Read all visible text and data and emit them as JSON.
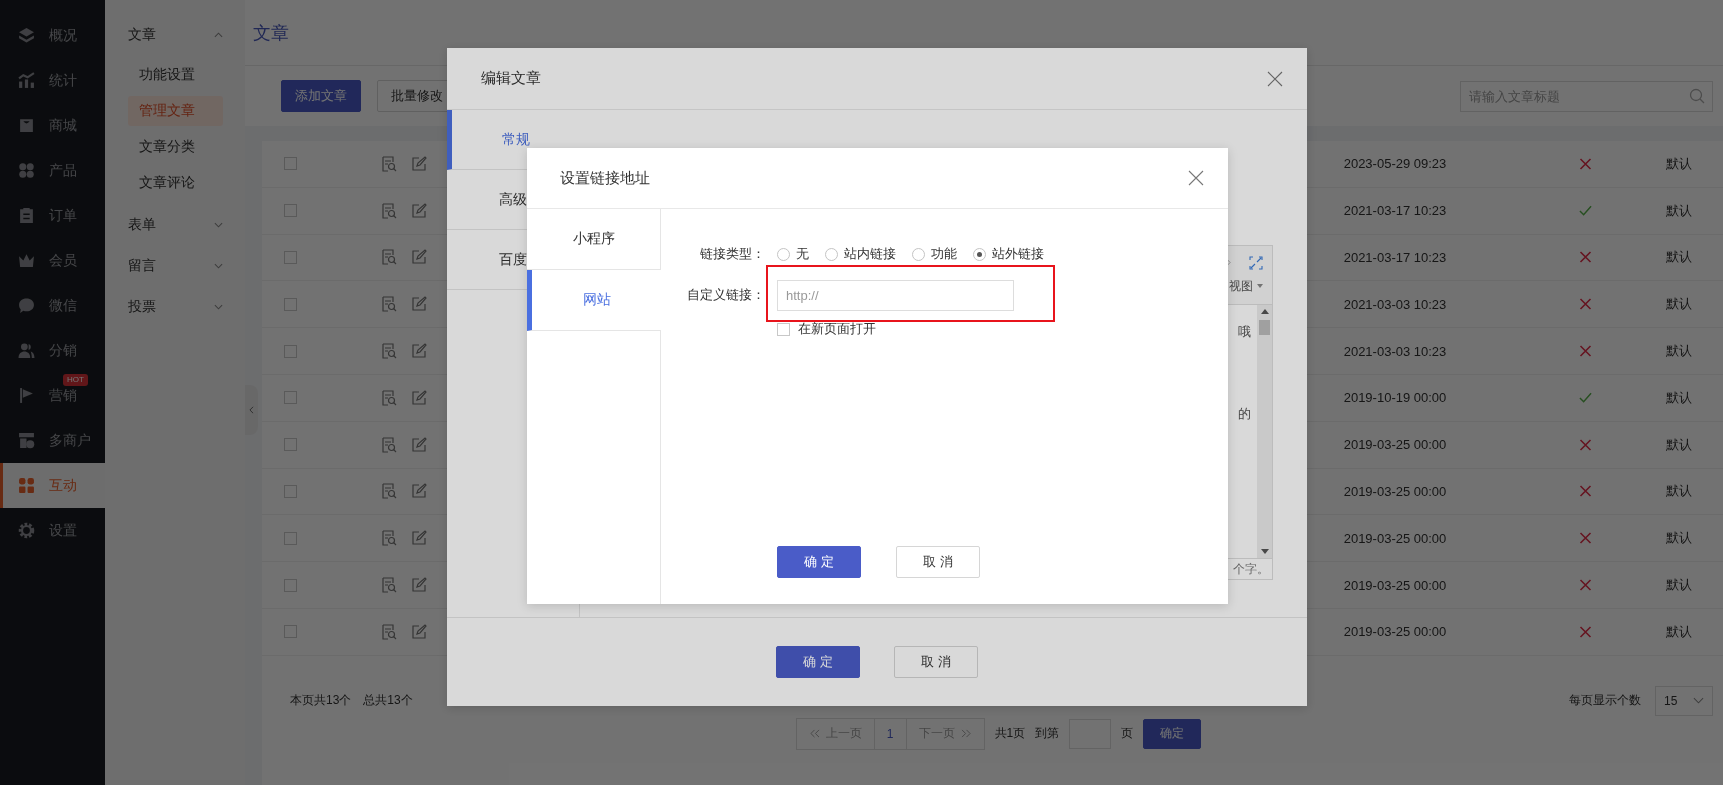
{
  "nav": [
    {
      "label": "概况",
      "selected": false
    },
    {
      "label": "统计",
      "selected": false
    },
    {
      "label": "商城",
      "selected": false
    },
    {
      "label": "产品",
      "selected": false
    },
    {
      "label": "订单",
      "selected": false
    },
    {
      "label": "会员",
      "selected": false
    },
    {
      "label": "微信",
      "selected": false
    },
    {
      "label": "分销",
      "selected": false
    },
    {
      "label": "营销",
      "selected": false,
      "badge": "HOT"
    },
    {
      "label": "多商户",
      "selected": false
    },
    {
      "label": "互动",
      "selected": true
    },
    {
      "label": "设置",
      "selected": false
    }
  ],
  "subnav": [
    {
      "label": "文章",
      "expanded": true,
      "children": [
        {
          "label": "功能设置",
          "selected": false
        },
        {
          "label": "管理文章",
          "selected": true
        },
        {
          "label": "文章分类",
          "selected": false
        },
        {
          "label": "文章评论",
          "selected": false
        }
      ]
    },
    {
      "label": "表单",
      "expanded": false
    },
    {
      "label": "留言",
      "expanded": false
    },
    {
      "label": "投票",
      "expanded": false
    }
  ],
  "page": {
    "title": "文章"
  },
  "toolbar": {
    "buttons": [
      {
        "label": "添加文章",
        "kind": "primary"
      },
      {
        "label": "批量修改",
        "kind": "default"
      }
    ],
    "search": {
      "placeholder": "请输入文章标题"
    }
  },
  "table": {
    "rows": [
      {
        "checked": false,
        "date": "2023-05-29 09:23",
        "published": false,
        "template": "默认"
      },
      {
        "checked": false,
        "date": "2021-03-17 10:23",
        "published": true,
        "template": "默认"
      },
      {
        "checked": false,
        "date": "2021-03-17 10:23",
        "published": false,
        "template": "默认"
      },
      {
        "checked": false,
        "date": "2021-03-03 10:23",
        "published": false,
        "template": "默认"
      },
      {
        "checked": false,
        "date": "2021-03-03 10:23",
        "published": false,
        "template": "默认"
      },
      {
        "checked": false,
        "date": "2019-10-19 00:00",
        "published": true,
        "template": "默认"
      },
      {
        "checked": false,
        "date": "2019-03-25 00:00",
        "published": false,
        "template": "默认"
      },
      {
        "checked": false,
        "date": "2019-03-25 00:00",
        "published": false,
        "template": "默认"
      },
      {
        "checked": false,
        "date": "2019-03-25 00:00",
        "published": false,
        "template": "默认"
      },
      {
        "checked": false,
        "date": "2019-03-25 00:00",
        "published": false,
        "template": "默认"
      },
      {
        "checked": false,
        "date": "2019-03-25 00:00",
        "published": false,
        "template": "默认"
      }
    ]
  },
  "footer": {
    "summary": [
      "本页共13个",
      "总共13个"
    ],
    "page_size_label": "每页显示个数",
    "page_size": "15"
  },
  "pagination": {
    "prev": {
      "label": "上一页",
      "disabled": true
    },
    "pages": [
      {
        "label": "1",
        "selected": true
      }
    ],
    "next": {
      "label": "下一页",
      "disabled": true
    },
    "total": "共1页",
    "goto_label": "到第",
    "goto_suffix": "页",
    "goto_button": "确定"
  },
  "edit_dialog": {
    "title": "编辑文章",
    "tabs": [
      {
        "label": "常规",
        "selected": true
      },
      {
        "label": "高级",
        "selected": false
      },
      {
        "label": "百度",
        "selected": false
      }
    ],
    "editor": {
      "toolbar_item": "视图",
      "fragments": [
        "哦",
        "的"
      ],
      "counter": "个字。"
    },
    "buttons": [
      {
        "label": "确定",
        "kind": "primary"
      },
      {
        "label": "取消",
        "kind": "default"
      }
    ]
  },
  "link_dialog": {
    "title": "设置链接地址",
    "tabs": [
      {
        "label": "小程序",
        "selected": false
      },
      {
        "label": "网站",
        "selected": true
      }
    ],
    "link_type": {
      "label": "链接类型：",
      "options": [
        {
          "label": "无",
          "selected": false
        },
        {
          "label": "站内链接",
          "selected": false
        },
        {
          "label": "功能",
          "selected": false
        },
        {
          "label": "站外链接",
          "selected": true
        }
      ]
    },
    "custom_link": {
      "label": "自定义链接：",
      "placeholder": "http://"
    },
    "new_window": {
      "label": "在新页面打开",
      "checked": false
    },
    "highlighted": true,
    "buttons": [
      {
        "label": "确定",
        "kind": "primary"
      },
      {
        "label": "取消",
        "kind": "default"
      }
    ]
  }
}
